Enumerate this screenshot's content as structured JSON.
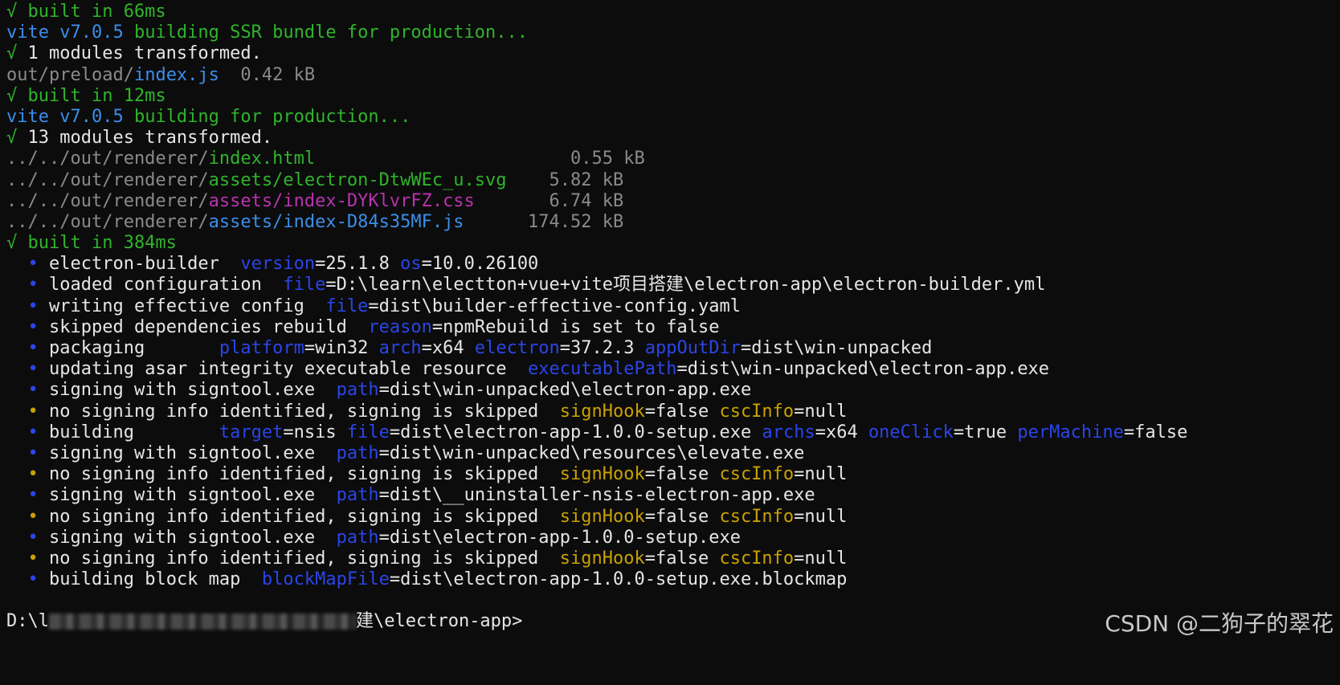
{
  "lines": [
    {
      "type": "plain",
      "segments": [
        {
          "c": "green",
          "t": "√ built in 66ms"
        }
      ]
    },
    {
      "type": "plain",
      "segments": [
        {
          "c": "blue",
          "t": "vite v7.0.5 "
        },
        {
          "c": "green",
          "t": "building SSR bundle for production..."
        }
      ]
    },
    {
      "type": "plain",
      "segments": [
        {
          "c": "green",
          "t": "√ "
        },
        {
          "c": "white",
          "t": "1 modules transformed."
        }
      ]
    },
    {
      "type": "plain",
      "segments": [
        {
          "c": "gray",
          "t": "out/preload/"
        },
        {
          "c": "blue",
          "t": "index.js"
        },
        {
          "c": "gray",
          "t": "  0.42 kB"
        }
      ]
    },
    {
      "type": "plain",
      "segments": [
        {
          "c": "green",
          "t": "√ built in 12ms"
        }
      ]
    },
    {
      "type": "plain",
      "segments": [
        {
          "c": "blue",
          "t": "vite v7.0.5 "
        },
        {
          "c": "green",
          "t": "building for production..."
        }
      ]
    },
    {
      "type": "plain",
      "segments": [
        {
          "c": "green",
          "t": "√ "
        },
        {
          "c": "white",
          "t": "13 modules transformed."
        }
      ]
    },
    {
      "type": "plain",
      "segments": [
        {
          "c": "gray",
          "t": "../../out/renderer/"
        },
        {
          "c": "green",
          "t": "index.html"
        },
        {
          "c": "gray",
          "t": "                        0.55 kB"
        }
      ]
    },
    {
      "type": "plain",
      "segments": [
        {
          "c": "gray",
          "t": "../../out/renderer/"
        },
        {
          "c": "green",
          "t": "assets/electron-DtwWEc_u.svg"
        },
        {
          "c": "gray",
          "t": "    5.82 kB"
        }
      ]
    },
    {
      "type": "plain",
      "segments": [
        {
          "c": "gray",
          "t": "../../out/renderer/"
        },
        {
          "c": "magenta",
          "t": "assets/index-DYKlvrFZ.css"
        },
        {
          "c": "gray",
          "t": "       6.74 kB"
        }
      ]
    },
    {
      "type": "plain",
      "segments": [
        {
          "c": "gray",
          "t": "../../out/renderer/"
        },
        {
          "c": "blue",
          "t": "assets/index-D84s35MF.js"
        },
        {
          "c": "gray",
          "t": "      174.52 kB"
        }
      ]
    },
    {
      "type": "plain",
      "segments": [
        {
          "c": "green",
          "t": "√ built in 384ms"
        }
      ]
    },
    {
      "type": "bullet",
      "color": "blue",
      "segments": [
        {
          "c": "white",
          "t": "electron-builder  "
        },
        {
          "c": "kblue",
          "t": "version"
        },
        {
          "c": "white",
          "t": "=25.1.8 "
        },
        {
          "c": "kblue",
          "t": "os"
        },
        {
          "c": "white",
          "t": "=10.0.26100"
        }
      ]
    },
    {
      "type": "bullet",
      "color": "blue",
      "segments": [
        {
          "c": "white",
          "t": "loaded configuration  "
        },
        {
          "c": "kblue",
          "t": "file"
        },
        {
          "c": "white",
          "t": "=D:\\learn\\electton+vue+vite项目搭建\\electron-app\\electron-builder.yml"
        }
      ]
    },
    {
      "type": "bullet",
      "color": "blue",
      "segments": [
        {
          "c": "white",
          "t": "writing effective config  "
        },
        {
          "c": "kblue",
          "t": "file"
        },
        {
          "c": "white",
          "t": "=dist\\builder-effective-config.yaml"
        }
      ]
    },
    {
      "type": "bullet",
      "color": "blue",
      "segments": [
        {
          "c": "white",
          "t": "skipped dependencies rebuild  "
        },
        {
          "c": "kblue",
          "t": "reason"
        },
        {
          "c": "white",
          "t": "=npmRebuild is set to false"
        }
      ]
    },
    {
      "type": "bullet",
      "color": "blue",
      "segments": [
        {
          "c": "white",
          "t": "packaging       "
        },
        {
          "c": "kblue",
          "t": "platform"
        },
        {
          "c": "white",
          "t": "=win32 "
        },
        {
          "c": "kblue",
          "t": "arch"
        },
        {
          "c": "white",
          "t": "=x64 "
        },
        {
          "c": "kblue",
          "t": "electron"
        },
        {
          "c": "white",
          "t": "=37.2.3 "
        },
        {
          "c": "kblue",
          "t": "appOutDir"
        },
        {
          "c": "white",
          "t": "=dist\\win-unpacked"
        }
      ]
    },
    {
      "type": "bullet",
      "color": "blue",
      "segments": [
        {
          "c": "white",
          "t": "updating asar integrity executable resource  "
        },
        {
          "c": "kblue",
          "t": "executablePath"
        },
        {
          "c": "white",
          "t": "=dist\\win-unpacked\\electron-app.exe"
        }
      ]
    },
    {
      "type": "bullet",
      "color": "blue",
      "segments": [
        {
          "c": "white",
          "t": "signing with signtool.exe  "
        },
        {
          "c": "kblue",
          "t": "path"
        },
        {
          "c": "white",
          "t": "=dist\\win-unpacked\\electron-app.exe"
        }
      ]
    },
    {
      "type": "bullet",
      "color": "yellow",
      "segments": [
        {
          "c": "white",
          "t": "no signing info identified, signing is skipped  "
        },
        {
          "c": "kyellow",
          "t": "signHook"
        },
        {
          "c": "white",
          "t": "=false "
        },
        {
          "c": "kyellow",
          "t": "cscInfo"
        },
        {
          "c": "white",
          "t": "=null"
        }
      ]
    },
    {
      "type": "bullet",
      "color": "blue",
      "segments": [
        {
          "c": "white",
          "t": "building        "
        },
        {
          "c": "kblue",
          "t": "target"
        },
        {
          "c": "white",
          "t": "=nsis "
        },
        {
          "c": "kblue",
          "t": "file"
        },
        {
          "c": "white",
          "t": "=dist\\electron-app-1.0.0-setup.exe "
        },
        {
          "c": "kblue",
          "t": "archs"
        },
        {
          "c": "white",
          "t": "=x64 "
        },
        {
          "c": "kblue",
          "t": "oneClick"
        },
        {
          "c": "white",
          "t": "=true "
        },
        {
          "c": "kblue",
          "t": "perMachine"
        },
        {
          "c": "white",
          "t": "=false"
        }
      ]
    },
    {
      "type": "bullet",
      "color": "blue",
      "segments": [
        {
          "c": "white",
          "t": "signing with signtool.exe  "
        },
        {
          "c": "kblue",
          "t": "path"
        },
        {
          "c": "white",
          "t": "=dist\\win-unpacked\\resources\\elevate.exe"
        }
      ]
    },
    {
      "type": "bullet",
      "color": "yellow",
      "segments": [
        {
          "c": "white",
          "t": "no signing info identified, signing is skipped  "
        },
        {
          "c": "kyellow",
          "t": "signHook"
        },
        {
          "c": "white",
          "t": "=false "
        },
        {
          "c": "kyellow",
          "t": "cscInfo"
        },
        {
          "c": "white",
          "t": "=null"
        }
      ]
    },
    {
      "type": "bullet",
      "color": "blue",
      "segments": [
        {
          "c": "white",
          "t": "signing with signtool.exe  "
        },
        {
          "c": "kblue",
          "t": "path"
        },
        {
          "c": "white",
          "t": "=dist\\__uninstaller-nsis-electron-app.exe"
        }
      ]
    },
    {
      "type": "bullet",
      "color": "yellow",
      "segments": [
        {
          "c": "white",
          "t": "no signing info identified, signing is skipped  "
        },
        {
          "c": "kyellow",
          "t": "signHook"
        },
        {
          "c": "white",
          "t": "=false "
        },
        {
          "c": "kyellow",
          "t": "cscInfo"
        },
        {
          "c": "white",
          "t": "=null"
        }
      ]
    },
    {
      "type": "bullet",
      "color": "blue",
      "segments": [
        {
          "c": "white",
          "t": "signing with signtool.exe  "
        },
        {
          "c": "kblue",
          "t": "path"
        },
        {
          "c": "white",
          "t": "=dist\\electron-app-1.0.0-setup.exe"
        }
      ]
    },
    {
      "type": "bullet",
      "color": "yellow",
      "segments": [
        {
          "c": "white",
          "t": "no signing info identified, signing is skipped  "
        },
        {
          "c": "kyellow",
          "t": "signHook"
        },
        {
          "c": "white",
          "t": "=false "
        },
        {
          "c": "kyellow",
          "t": "cscInfo"
        },
        {
          "c": "white",
          "t": "=null"
        }
      ]
    },
    {
      "type": "bullet",
      "color": "blue",
      "segments": [
        {
          "c": "white",
          "t": "building block map  "
        },
        {
          "c": "kblue",
          "t": "blockMapFile"
        },
        {
          "c": "white",
          "t": "=dist\\electron-app-1.0.0-setup.exe.blockmap"
        }
      ]
    },
    {
      "type": "blank"
    },
    {
      "type": "prompt",
      "prefix": "D:\\l",
      "suffix": "建\\electron-app>"
    }
  ],
  "bullet_glyph": "•",
  "watermark": "CSDN @二狗子的翠花",
  "colors": {
    "background": "#0c0c0c",
    "green": "#2fb42c",
    "blue": "#3b8eea",
    "gray": "#8a8a8a",
    "magenta": "#b832b0",
    "key_blue": "#2a45e8",
    "key_yellow": "#c9a100"
  }
}
